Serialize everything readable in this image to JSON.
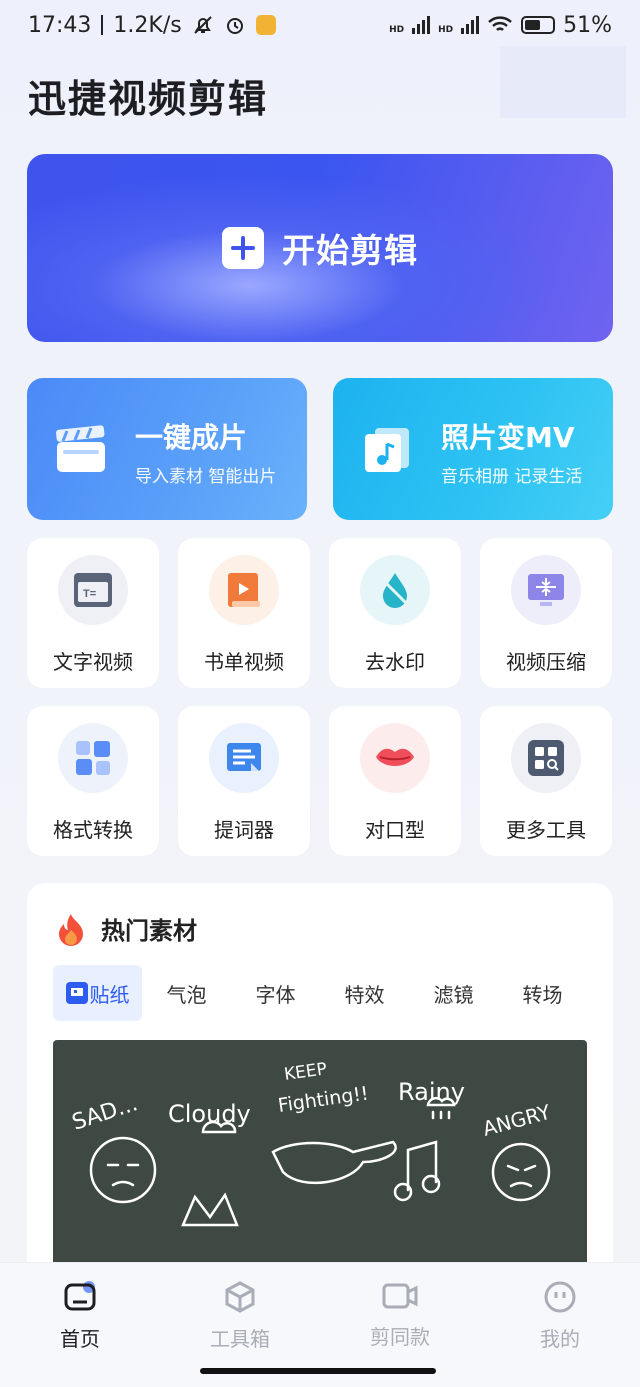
{
  "status_bar": {
    "time": "17:43",
    "speed": "1.2K/s",
    "battery": "51%",
    "hd1": "HD",
    "hd2": "HD"
  },
  "app_title": "迅捷视频剪辑",
  "hero": {
    "label": "开始剪辑"
  },
  "features": [
    {
      "title": "一键成片",
      "subtitle": "导入素材 智能出片",
      "icon": "clapperboard-icon"
    },
    {
      "title": "照片变MV",
      "subtitle": "音乐相册 记录生活",
      "icon": "music-photo-icon"
    }
  ],
  "tools": [
    {
      "label": "文字视频",
      "icon": "text-video-icon",
      "bg": "#eef0f5"
    },
    {
      "label": "书单视频",
      "icon": "book-video-icon",
      "bg": "#fdf0e6"
    },
    {
      "label": "去水印",
      "icon": "remove-watermark-icon",
      "bg": "#e6f6f8"
    },
    {
      "label": "视频压缩",
      "icon": "compress-video-icon",
      "bg": "#eeeefb"
    },
    {
      "label": "格式转换",
      "icon": "format-convert-icon",
      "bg": "#eef2fb"
    },
    {
      "label": "提词器",
      "icon": "teleprompter-icon",
      "bg": "#e8f1fd"
    },
    {
      "label": "对口型",
      "icon": "lip-sync-icon",
      "bg": "#fcecec"
    },
    {
      "label": "更多工具",
      "icon": "more-tools-icon",
      "bg": "#eef0f5"
    }
  ],
  "hot": {
    "title": "热门素材",
    "tabs": [
      "贴纸",
      "气泡",
      "字体",
      "特效",
      "滤镜",
      "转场"
    ],
    "active_tab": "贴纸",
    "board_words": [
      "SAD...",
      "Cloudy",
      "KEEP",
      "Fighting!!",
      "Rainy",
      "ANGRY"
    ]
  },
  "nav": [
    {
      "label": "首页",
      "icon": "home-icon",
      "active": true
    },
    {
      "label": "工具箱",
      "icon": "toolbox-icon",
      "active": false
    },
    {
      "label": "剪同款",
      "icon": "video-camera-icon",
      "active": false
    },
    {
      "label": "我的",
      "icon": "profile-icon",
      "active": false
    }
  ],
  "colors": {
    "accent": "#2e5bf0",
    "hero": "#3f54ec",
    "feature_left": "#4a8af8",
    "feature_right": "#1cb2ef"
  }
}
